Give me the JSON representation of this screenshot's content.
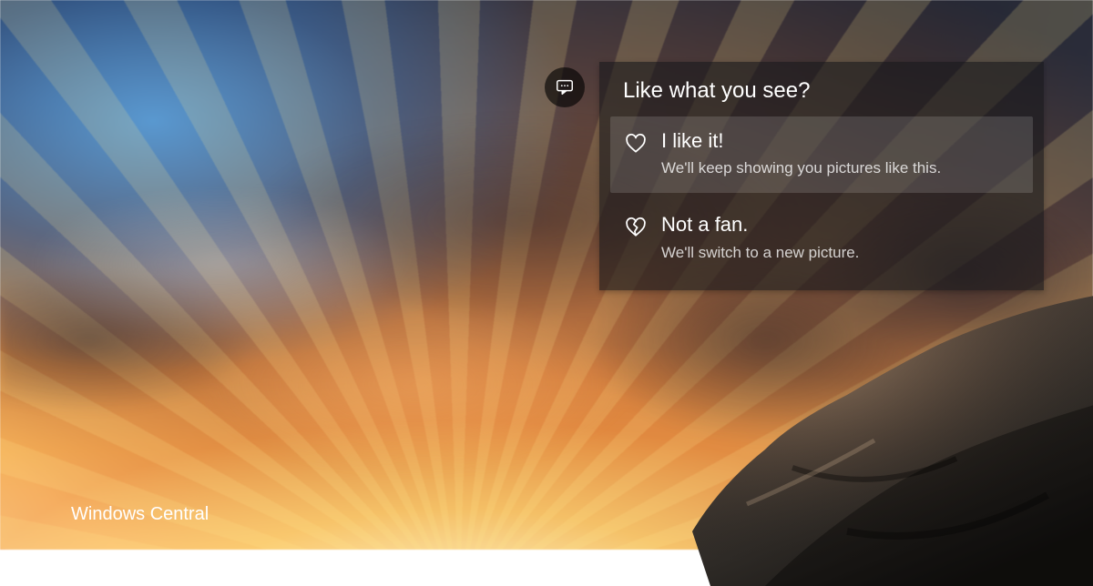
{
  "feedback": {
    "title": "Like what you see?",
    "options": [
      {
        "icon": "heart-icon",
        "title": "I like it!",
        "subtitle": "We'll keep showing you pictures like this.",
        "selected": true
      },
      {
        "icon": "broken-heart-icon",
        "title": "Not a fan.",
        "subtitle": "We'll switch to a new picture.",
        "selected": false
      }
    ]
  },
  "watermark": {
    "text": "Windows Central"
  }
}
